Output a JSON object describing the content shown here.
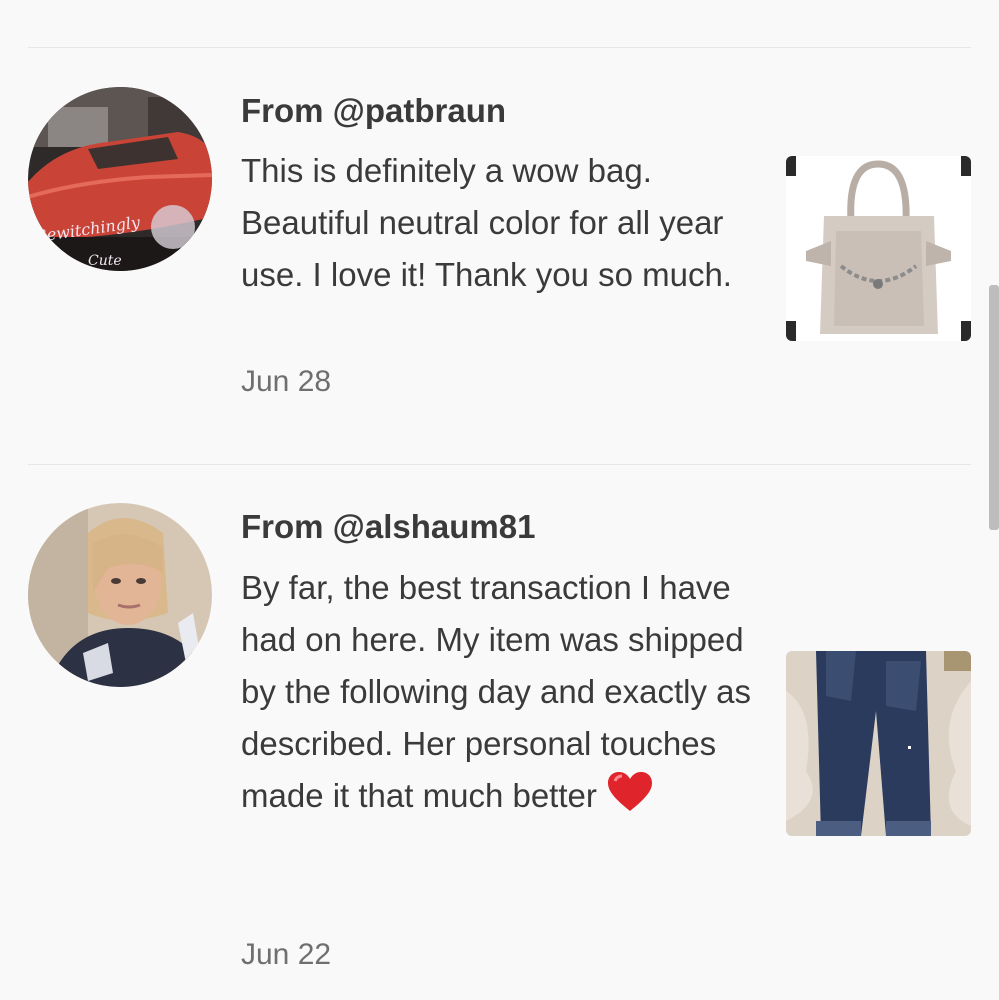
{
  "reviews": [
    {
      "author": "From @patbraun",
      "text": "This is definitely a wow bag. Beautiful neutral color for all year use. I love it! Thank you so much.",
      "date": "Jun 28",
      "avatar_icon": "car-profile-photo",
      "avatar_caption": "Bewitchingly Cute",
      "thumbnail_icon": "handbag-photo"
    },
    {
      "author": "From @alshaum81",
      "text": "By far, the best transaction I have had on here. My item was shipped by the following day and exactly as described. Her personal touches made it that much better",
      "date": "Jun 22",
      "avatar_icon": "person-profile-photo",
      "thumbnail_icon": "jeans-photo",
      "emoji": "heart-emoji"
    }
  ],
  "colors": {
    "background": "#f9f9f9",
    "divider": "#e6e6e6",
    "text": "#3a3a3a",
    "date": "#6f6f6f",
    "heart": "#e0242b"
  }
}
